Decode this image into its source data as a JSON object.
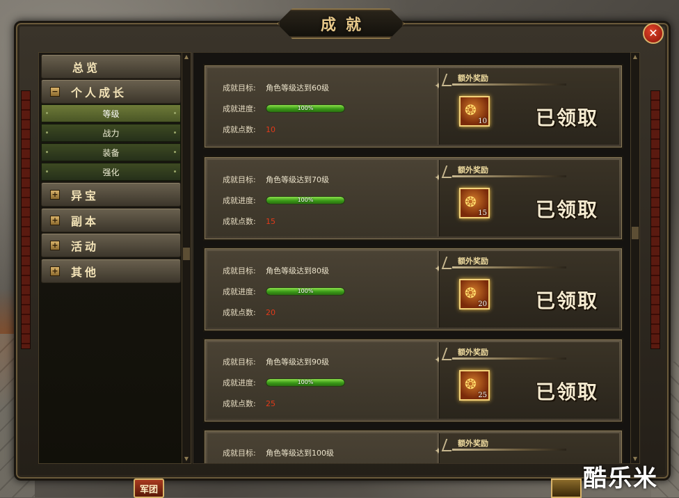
{
  "window": {
    "title": "成就"
  },
  "nav": {
    "overview": "总览",
    "personal_growth": {
      "label": "个人成长",
      "toggle": "−"
    },
    "subitems": [
      "等级",
      "战力",
      "装备",
      "强化"
    ],
    "categories": [
      {
        "label": "异宝",
        "toggle": "+"
      },
      {
        "label": "副本",
        "toggle": "+"
      },
      {
        "label": "活动",
        "toggle": "+"
      },
      {
        "label": "其他",
        "toggle": "+"
      }
    ]
  },
  "labels": {
    "goal": "成就目标:",
    "progress": "成就进度:",
    "points": "成就点数:",
    "extra_reward": "额外奖励",
    "claimed": "已领取"
  },
  "achievements": [
    {
      "goal": "角色等级达到60级",
      "progress_pct": 100,
      "progress_text": "100%",
      "points": "10",
      "reward_count": "10"
    },
    {
      "goal": "角色等级达到70级",
      "progress_pct": 100,
      "progress_text": "100%",
      "points": "15",
      "reward_count": "15"
    },
    {
      "goal": "角色等级达到80级",
      "progress_pct": 100,
      "progress_text": "100%",
      "points": "20",
      "reward_count": "20"
    },
    {
      "goal": "角色等级达到90级",
      "progress_pct": 100,
      "progress_text": "100%",
      "points": "25",
      "reward_count": "25"
    },
    {
      "goal": "角色等级达到100级"
    }
  ],
  "bottom": {
    "army_button": "军团",
    "watermark": "酷乐米"
  },
  "icons": {
    "close": "close-icon",
    "reward_item": "gold-coins-icon"
  },
  "colors": {
    "accent_gold": "#e8c98a",
    "points_red": "#e23a1a",
    "progress_green": "#3a9a18"
  }
}
